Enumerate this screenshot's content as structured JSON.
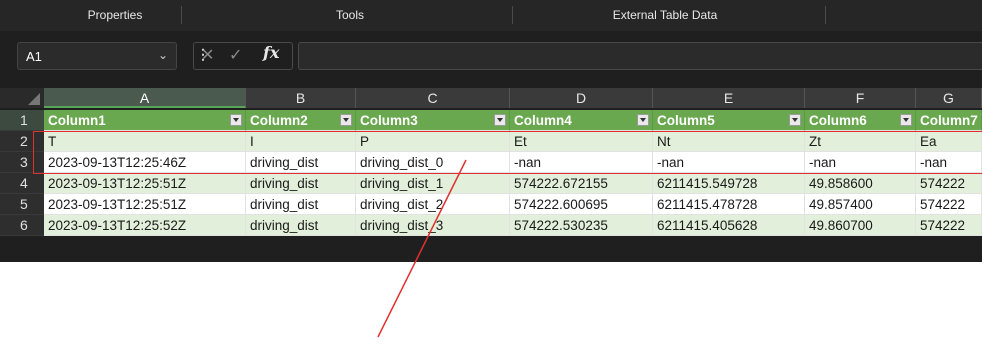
{
  "ribbon": {
    "groups": [
      "Properties",
      "Tools",
      "External Table Data"
    ]
  },
  "formula_bar": {
    "name_box": "A1",
    "name_box_arrow": "⌄",
    "dots": "⋮",
    "cancel": "✕",
    "enter": "✓",
    "fx": "fx",
    "formula": ""
  },
  "grid": {
    "columns": [
      "A",
      "B",
      "C",
      "D",
      "E",
      "F",
      "G"
    ],
    "row_numbers": [
      "1",
      "2",
      "3",
      "4",
      "5",
      "6"
    ],
    "rows": [
      [
        "Column1",
        "Column2",
        "Column3",
        "Column4",
        "Column5",
        "Column6",
        "Column7"
      ],
      [
        "T",
        "I",
        "P",
        "Et",
        "Nt",
        "Zt",
        "Ea"
      ],
      [
        "2023-09-13T12:25:46Z",
        "driving_dist",
        "driving_dist_0",
        "-nan",
        "-nan",
        "-nan",
        "-nan"
      ],
      [
        "2023-09-13T12:25:51Z",
        "driving_dist",
        "driving_dist_1",
        "574222.672155",
        "6211415.549728",
        "49.858600",
        "574222"
      ],
      [
        "2023-09-13T12:25:51Z",
        "driving_dist",
        "driving_dist_2",
        "574222.600695",
        "6211415.478728",
        "49.857400",
        "574222"
      ],
      [
        "2023-09-13T12:25:52Z",
        "driving_dist",
        "driving_dist_3",
        "574222.530235",
        "6211415.405628",
        "49.860700",
        "574222"
      ]
    ]
  },
  "colors": {
    "header_green": "#6aa84f",
    "band_green": "#e2efda",
    "annotation_red": "#e03030"
  }
}
